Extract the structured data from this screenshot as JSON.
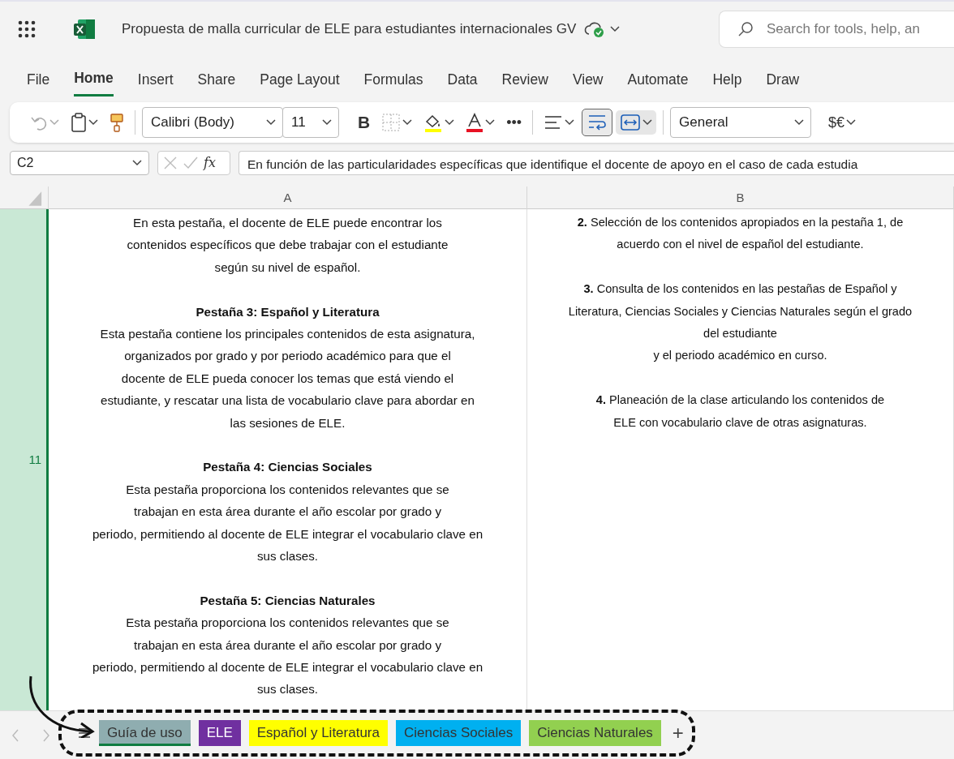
{
  "title_bar": {
    "document_title": "Propuesta de malla curricular de ELE para estudiantes internacionales GV",
    "search": {
      "placeholder": "Search for tools, help, an"
    }
  },
  "menu": [
    {
      "label": "File",
      "selected": false
    },
    {
      "label": "Home",
      "selected": true
    },
    {
      "label": "Insert",
      "selected": false
    },
    {
      "label": "Share",
      "selected": false
    },
    {
      "label": "Page Layout",
      "selected": false
    },
    {
      "label": "Formulas",
      "selected": false
    },
    {
      "label": "Data",
      "selected": false
    },
    {
      "label": "Review",
      "selected": false
    },
    {
      "label": "View",
      "selected": false
    },
    {
      "label": "Automate",
      "selected": false
    },
    {
      "label": "Help",
      "selected": false
    },
    {
      "label": "Draw",
      "selected": false
    }
  ],
  "toolbar": {
    "undo_disabled": true,
    "font": "Calibri (Body)",
    "size": "11",
    "bold": "B",
    "more": "•••",
    "wrap_text_on": true,
    "merge_on": true,
    "number_format": "General",
    "currency": "$€"
  },
  "formula_bar": {
    "name_box": "C2",
    "fx": "fx",
    "formula": "En función de las particularidades específicas que identifique el docente de apoyo en el caso de cada estudia"
  },
  "grid": {
    "columns": [
      "A",
      "B"
    ],
    "row_label": "11",
    "column_a": [
      {
        "lines": [
          "En esta pestaña, el docente de ELE puede encontrar los",
          "contenidos específicos que debe trabajar con el estudiante",
          "según su nivel de español."
        ]
      },
      {
        "heading": "Pestaña 3: Español y Literatura",
        "lines": [
          "Esta pestaña contiene los principales contenidos de esta asignatura,",
          "organizados por grado y por periodo académico para que el",
          "docente de ELE pueda conocer los temas que está viendo el",
          "estudiante, y rescatar una lista de vocabulario clave para abordar en",
          "las sesiones de ELE."
        ]
      },
      {
        "heading": "Pestaña 4: Ciencias Sociales",
        "lines": [
          "Esta pestaña proporciona los contenidos relevantes que se",
          "trabajan en esta área durante el año escolar por grado y",
          "periodo, permitiendo al docente de ELE integrar el vocabulario clave en",
          "sus clases."
        ]
      },
      {
        "heading": "Pestaña 5: Ciencias Naturales",
        "lines": [
          "Esta pestaña proporciona los contenidos relevantes que se",
          "trabajan en esta área durante el año escolar por grado y",
          "periodo, permitiendo al docente de ELE integrar el vocabulario clave en",
          "sus clases."
        ]
      }
    ],
    "column_b": [
      {
        "lines": [
          "**2.** Selección de los contenidos apropiados en la pestaña 1, de",
          "acuerdo con el nivel de español del estudiante."
        ]
      },
      {
        "lines": [
          "**3.** Consulta de los contenidos en las pestañas de Español y",
          "Literatura, Ciencias Sociales y Ciencias Naturales según el grado",
          "del estudiante",
          "y el periodo académico en curso."
        ]
      },
      {
        "lines": [
          "**4.** Planeación de la clase articulando los contenidos de",
          "ELE con vocabulario clave de otras asignaturas."
        ]
      }
    ]
  },
  "sheet_tabs": [
    {
      "label": "Guía de uso",
      "color": "#8fadb0",
      "selected": true
    },
    {
      "label": "ELE",
      "color": "#7030a0",
      "selected": false
    },
    {
      "label": "Español y Literatura",
      "color": "#ffff00",
      "selected": false
    },
    {
      "label": "Ciencias Sociales",
      "color": "#00b0f0",
      "selected": false
    },
    {
      "label": "Ciencias Naturales",
      "color": "#92d050",
      "selected": false
    }
  ],
  "add_sheet": "+"
}
